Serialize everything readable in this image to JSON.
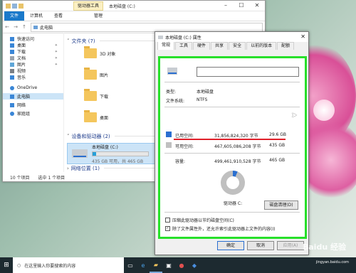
{
  "explorer": {
    "title": "本地磁盘 (C:)",
    "drive_tools_tab": "驱动器工具",
    "ribbon_tabs": [
      "文件",
      "计算机",
      "查看",
      "管理"
    ],
    "address": "此电脑",
    "sidebar": [
      {
        "label": "快速访问",
        "icon": "star-icon"
      },
      {
        "label": "桌面",
        "icon": "desktop-icon",
        "pinned": true
      },
      {
        "label": "下载",
        "icon": "download-icon",
        "pinned": true
      },
      {
        "label": "文档",
        "icon": "document-icon",
        "pinned": true
      },
      {
        "label": "图片",
        "icon": "picture-icon",
        "pinned": true
      },
      {
        "label": "视频",
        "icon": "video-icon"
      },
      {
        "label": "音乐",
        "icon": "music-icon"
      },
      {
        "label": "OneDrive",
        "icon": "cloud-icon"
      },
      {
        "label": "此电脑",
        "icon": "computer-icon",
        "selected": true
      },
      {
        "label": "网络",
        "icon": "network-icon"
      },
      {
        "label": "家庭组",
        "icon": "homegroup-icon"
      }
    ],
    "folders_header": "文件夹 (7)",
    "folders": [
      "3D 对象",
      "图片",
      "下载",
      "桌面"
    ],
    "devices_header": "设备和驱动器 (2)",
    "drive": {
      "name": "本地磁盘 (C:)",
      "space": "435 GB 可用，共 465 GB",
      "used_fraction": 0.064
    },
    "network_header": "网络位置 (1)",
    "status_count": "10 个项目",
    "status_selected": "选中 1 个项目"
  },
  "properties": {
    "title": "本地磁盘 (C:) 属性",
    "tabs": [
      "常规",
      "工具",
      "硬件",
      "共享",
      "安全",
      "以前的版本",
      "配额"
    ],
    "type_label": "类型:",
    "type_value": "本地磁盘",
    "fs_label": "文件系统:",
    "fs_value": "NTFS",
    "used_label": "已用空间:",
    "used_bytes": "31,856,824,320 字节",
    "used_gb": "29.6 GB",
    "free_label": "可用空间:",
    "free_bytes": "467,605,086,208 字节",
    "free_gb": "435 GB",
    "cap_label": "容量:",
    "cap_bytes": "499,461,910,528 字节",
    "cap_gb": "465 GB",
    "drive_label": "驱动器 C:",
    "cleanup_button": "磁盘清理(D)",
    "compress_label": "压缩此驱动器以节约磁盘空间(C)",
    "index_label": "除了文件属性外，还允许索引此驱动器上文件的内容(I)",
    "index_checked": true,
    "ok": "确定",
    "cancel": "取消",
    "apply": "应用(A)",
    "used_color": "#2a6fd0",
    "free_color": "#c0c0c0",
    "highlight_color": "#27e02a"
  },
  "taskbar": {
    "search_placeholder": "在这里输入你要搜索的内容"
  },
  "watermark": {
    "text": "Baidu 经验",
    "url": "jingyan.baidu.com"
  }
}
